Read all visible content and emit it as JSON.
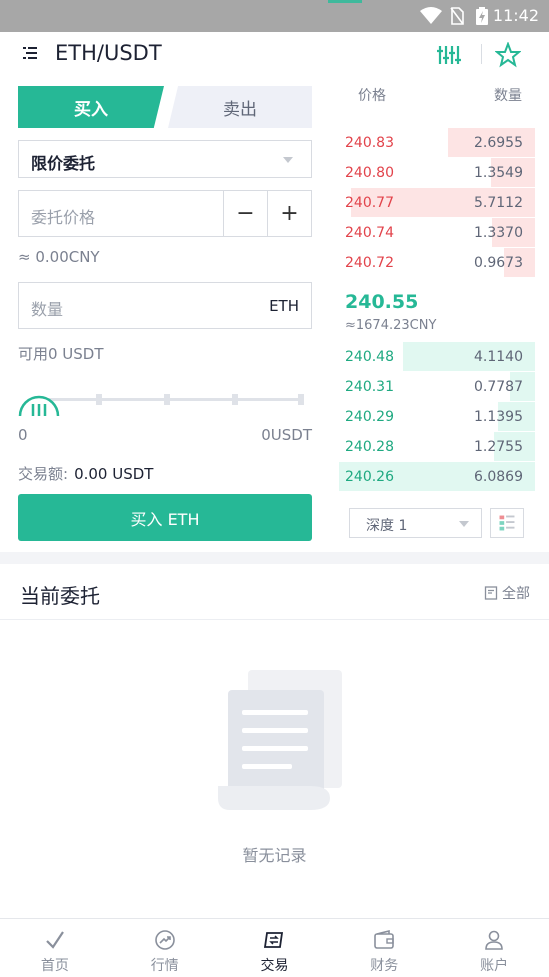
{
  "status_bar": {
    "time": "11:42"
  },
  "header": {
    "title": "ETH/USDT",
    "icons": [
      "menu-icon",
      "kline-settings-icon",
      "star-icon"
    ]
  },
  "trade": {
    "tab_buy": "买入",
    "tab_sell": "卖出",
    "order_type": "限价委托",
    "price_placeholder": "委托价格",
    "minus": "−",
    "plus": "+",
    "cny_estimate": "≈ 0.00CNY",
    "qty_placeholder": "数量",
    "qty_unit": "ETH",
    "available": "可用0 USDT",
    "slider_min": "0",
    "slider_max": "0USDT",
    "slider_value": 0,
    "amount_label": "交易额:",
    "amount_value": "0.00 USDT",
    "submit": "买入 ETH"
  },
  "orderbook": {
    "col_price": "价格",
    "col_qty": "数量",
    "asks": [
      {
        "price": "240.83",
        "qty": "2.6955"
      },
      {
        "price": "240.80",
        "qty": "1.3549"
      },
      {
        "price": "240.77",
        "qty": "5.7112"
      },
      {
        "price": "240.74",
        "qty": "1.3370"
      },
      {
        "price": "240.72",
        "qty": "0.9673"
      }
    ],
    "last_price": "240.55",
    "last_cny": "≈1674.23CNY",
    "bids": [
      {
        "price": "240.48",
        "qty": "4.1140"
      },
      {
        "price": "240.31",
        "qty": "0.7787"
      },
      {
        "price": "240.29",
        "qty": "1.1395"
      },
      {
        "price": "240.28",
        "qty": "1.2755"
      },
      {
        "price": "240.26",
        "qty": "6.0869"
      }
    ],
    "depth": "深度 1"
  },
  "orders": {
    "title": "当前委托",
    "all": "全部",
    "empty": "暂无记录"
  },
  "tabbar": [
    {
      "label": "首页",
      "icon": "check-icon"
    },
    {
      "label": "行情",
      "icon": "trend-icon"
    },
    {
      "label": "交易",
      "icon": "exchange-icon"
    },
    {
      "label": "财务",
      "icon": "wallet-icon"
    },
    {
      "label": "账户",
      "icon": "user-icon"
    }
  ],
  "colors": {
    "accent": "#26b896",
    "ask": "#e2434b",
    "bid": "#1fa981"
  }
}
